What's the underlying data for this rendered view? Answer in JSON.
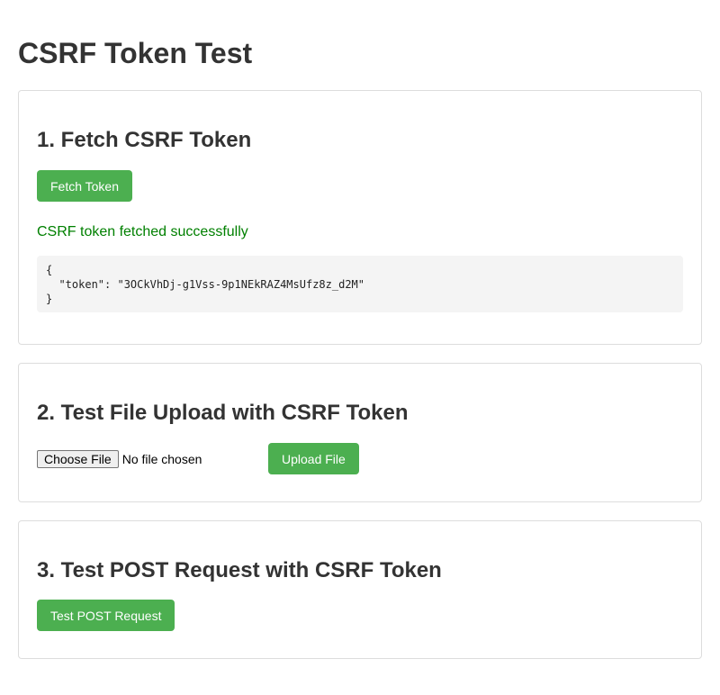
{
  "page": {
    "title": "CSRF Token Test"
  },
  "colors": {
    "accent_green": "#4caf50",
    "success_text": "#008000",
    "border": "#dddddd",
    "code_bg": "#f4f4f4"
  },
  "fetch_section": {
    "heading": "1. Fetch CSRF Token",
    "button_label": "Fetch Token",
    "status_text": "CSRF token fetched successfully",
    "response_json": "{\n  \"token\": \"3OCkVhDj-g1Vss-9p1NEkRAZ4MsUfz8z_d2M\"\n}"
  },
  "upload_section": {
    "heading": "2. Test File Upload with CSRF Token",
    "choose_file_label": "Choose File",
    "file_status": "No file chosen",
    "upload_button_label": "Upload File"
  },
  "post_section": {
    "heading": "3. Test POST Request with CSRF Token",
    "button_label": "Test POST Request"
  }
}
